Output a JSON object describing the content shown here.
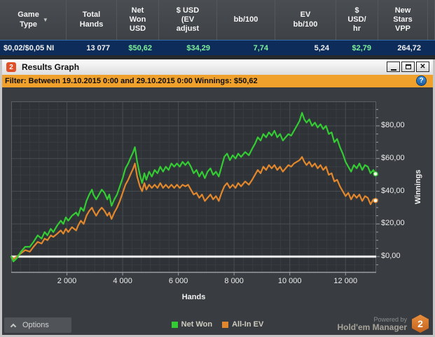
{
  "hud_table": {
    "columns": [
      {
        "label": "Game\nType",
        "width": 95,
        "sortable": true
      },
      {
        "label": "Total\nHands",
        "width": 72
      },
      {
        "label": "Net\nWon\nUSD",
        "width": 60
      },
      {
        "label": "$ USD\n(EV\nadjust",
        "width": 83
      },
      {
        "label": "bb/100",
        "width": 83
      },
      {
        "label": "EV\nbb/100",
        "width": 87
      },
      {
        "label": "$\nUSD/\nhr",
        "width": 60
      },
      {
        "label": "New\nStars\nVPP",
        "width": 71
      }
    ],
    "row": [
      {
        "value": "$0,02/$0,05 NI",
        "color": "white",
        "align": "left"
      },
      {
        "value": "13 077",
        "color": "white"
      },
      {
        "value": "$50,62",
        "color": "green"
      },
      {
        "value": "$34,29",
        "color": "green"
      },
      {
        "value": "7,74",
        "color": "green"
      },
      {
        "value": "5,24",
        "color": "white"
      },
      {
        "value": "$2,79",
        "color": "green"
      },
      {
        "value": "264,72",
        "color": "white"
      }
    ]
  },
  "window": {
    "title": "Results Graph",
    "logo_text": "2",
    "buttons": {
      "minimize": "_",
      "maximize": "",
      "close": "✕"
    },
    "filter_text": "Filter: Between 19.10.2015 0:00 and 29.10.2015 0:00 Winnings: $50,62",
    "help_icon": "?"
  },
  "footer": {
    "options_label": "Options",
    "powered_by_line1": "Powered by",
    "powered_by_line2": "Hold'em Manager",
    "logo_badge": "2"
  },
  "chart_data": {
    "type": "line",
    "xlabel": "Hands",
    "ylabel": "Winnings",
    "xlim": [
      0,
      13100
    ],
    "ylim": [
      -10,
      95
    ],
    "x_ticks": [
      2000,
      4000,
      6000,
      8000,
      10000,
      12000
    ],
    "x_tick_labels": [
      "2 000",
      "4 000",
      "6 000",
      "8 000",
      "10 000",
      "12 000"
    ],
    "y_ticks": [
      0,
      20,
      40,
      60,
      80
    ],
    "y_tick_labels": [
      "$0,00",
      "$20,00",
      "$40,00",
      "$60,00",
      "$80,00"
    ],
    "grid": true,
    "zero_line_color": "#f2f2f2",
    "legend_position": "bottom",
    "series": [
      {
        "name": "All-In EV",
        "color": "#e2872c",
        "final_value": "$34,29",
        "points": [
          [
            0,
            0
          ],
          [
            80,
            -1.5
          ],
          [
            200,
            0
          ],
          [
            350,
            2
          ],
          [
            500,
            4
          ],
          [
            670,
            3
          ],
          [
            800,
            6
          ],
          [
            950,
            9
          ],
          [
            1090,
            8
          ],
          [
            1200,
            11
          ],
          [
            1300,
            10
          ],
          [
            1420,
            13
          ],
          [
            1510,
            12
          ],
          [
            1650,
            14
          ],
          [
            1780,
            16
          ],
          [
            1870,
            14
          ],
          [
            1960,
            17
          ],
          [
            2050,
            15
          ],
          [
            2180,
            18
          ],
          [
            2330,
            16
          ],
          [
            2400,
            19
          ],
          [
            2500,
            22
          ],
          [
            2600,
            20
          ],
          [
            2700,
            25
          ],
          [
            2800,
            28
          ],
          [
            2900,
            30
          ],
          [
            2950,
            28
          ],
          [
            3050,
            25
          ],
          [
            3150,
            28
          ],
          [
            3250,
            30
          ],
          [
            3350,
            28
          ],
          [
            3450,
            25
          ],
          [
            3520,
            27
          ],
          [
            3600,
            23
          ],
          [
            3700,
            27
          ],
          [
            3800,
            30
          ],
          [
            3900,
            34
          ],
          [
            4000,
            39
          ],
          [
            4100,
            44
          ],
          [
            4200,
            47
          ],
          [
            4300,
            51
          ],
          [
            4380,
            54
          ],
          [
            4440,
            57
          ],
          [
            4520,
            49
          ],
          [
            4620,
            43
          ],
          [
            4700,
            40
          ],
          [
            4780,
            45
          ],
          [
            4850,
            41
          ],
          [
            4950,
            44
          ],
          [
            5050,
            42
          ],
          [
            5150,
            44
          ],
          [
            5250,
            42
          ],
          [
            5350,
            45
          ],
          [
            5450,
            42
          ],
          [
            5550,
            44
          ],
          [
            5650,
            42
          ],
          [
            5750,
            44
          ],
          [
            5850,
            42
          ],
          [
            5950,
            44
          ],
          [
            6050,
            42
          ],
          [
            6150,
            44
          ],
          [
            6250,
            43
          ],
          [
            6350,
            44
          ],
          [
            6450,
            41
          ],
          [
            6550,
            38
          ],
          [
            6650,
            39
          ],
          [
            6750,
            36
          ],
          [
            6850,
            38
          ],
          [
            6950,
            34
          ],
          [
            7050,
            36
          ],
          [
            7150,
            38
          ],
          [
            7250,
            35
          ],
          [
            7350,
            37
          ],
          [
            7450,
            34
          ],
          [
            7550,
            39
          ],
          [
            7650,
            43
          ],
          [
            7750,
            45
          ],
          [
            7850,
            42
          ],
          [
            7950,
            44
          ],
          [
            8050,
            42
          ],
          [
            8150,
            45
          ],
          [
            8250,
            43
          ],
          [
            8400,
            46
          ],
          [
            8530,
            44
          ],
          [
            8650,
            47
          ],
          [
            8750,
            50
          ],
          [
            8850,
            53
          ],
          [
            8950,
            51
          ],
          [
            9050,
            55
          ],
          [
            9150,
            53
          ],
          [
            9250,
            56
          ],
          [
            9350,
            54
          ],
          [
            9450,
            56
          ],
          [
            9550,
            53
          ],
          [
            9650,
            55
          ],
          [
            9750,
            52
          ],
          [
            9850,
            54
          ],
          [
            9950,
            56
          ],
          [
            10050,
            55
          ],
          [
            10150,
            57
          ],
          [
            10250,
            58
          ],
          [
            10350,
            59
          ],
          [
            10440,
            61
          ],
          [
            10520,
            58
          ],
          [
            10600,
            56
          ],
          [
            10700,
            58
          ],
          [
            10800,
            55
          ],
          [
            10900,
            57
          ],
          [
            11000,
            54
          ],
          [
            11100,
            56
          ],
          [
            11200,
            53
          ],
          [
            11300,
            55
          ],
          [
            11400,
            50
          ],
          [
            11500,
            51
          ],
          [
            11600,
            46
          ],
          [
            11700,
            47
          ],
          [
            11800,
            43
          ],
          [
            11900,
            40
          ],
          [
            12000,
            37
          ],
          [
            12100,
            39
          ],
          [
            12200,
            35
          ],
          [
            12300,
            38
          ],
          [
            12400,
            36
          ],
          [
            12500,
            38
          ],
          [
            12600,
            34
          ],
          [
            12700,
            37
          ],
          [
            12800,
            36
          ],
          [
            12900,
            32
          ],
          [
            13000,
            35
          ],
          [
            13077,
            34.3
          ]
        ]
      },
      {
        "name": "Net Won",
        "color": "#33cc33",
        "final_value": "$50,62",
        "points": [
          [
            0,
            0
          ],
          [
            80,
            -3
          ],
          [
            200,
            -1
          ],
          [
            350,
            3
          ],
          [
            500,
            6
          ],
          [
            670,
            6
          ],
          [
            800,
            9
          ],
          [
            950,
            13
          ],
          [
            1090,
            11
          ],
          [
            1200,
            15
          ],
          [
            1300,
            13
          ],
          [
            1420,
            17
          ],
          [
            1510,
            15
          ],
          [
            1650,
            19
          ],
          [
            1780,
            22
          ],
          [
            1870,
            20
          ],
          [
            1960,
            24
          ],
          [
            2050,
            22
          ],
          [
            2180,
            25
          ],
          [
            2330,
            27
          ],
          [
            2400,
            25
          ],
          [
            2500,
            30
          ],
          [
            2600,
            28
          ],
          [
            2700,
            34
          ],
          [
            2800,
            38
          ],
          [
            2900,
            41
          ],
          [
            2950,
            38
          ],
          [
            3050,
            35
          ],
          [
            3150,
            38
          ],
          [
            3250,
            41
          ],
          [
            3350,
            39
          ],
          [
            3450,
            35
          ],
          [
            3520,
            38
          ],
          [
            3600,
            31
          ],
          [
            3700,
            35
          ],
          [
            3800,
            38
          ],
          [
            3900,
            43
          ],
          [
            4000,
            48
          ],
          [
            4100,
            54
          ],
          [
            4200,
            57
          ],
          [
            4300,
            61
          ],
          [
            4380,
            64
          ],
          [
            4440,
            67
          ],
          [
            4520,
            58
          ],
          [
            4620,
            50
          ],
          [
            4700,
            45
          ],
          [
            4780,
            51
          ],
          [
            4850,
            47
          ],
          [
            4950,
            52
          ],
          [
            5050,
            49
          ],
          [
            5150,
            53
          ],
          [
            5250,
            51
          ],
          [
            5350,
            55
          ],
          [
            5450,
            52
          ],
          [
            5550,
            55
          ],
          [
            5650,
            53
          ],
          [
            5750,
            57
          ],
          [
            5850,
            55
          ],
          [
            5950,
            57
          ],
          [
            6050,
            55
          ],
          [
            6150,
            58
          ],
          [
            6250,
            56
          ],
          [
            6350,
            58
          ],
          [
            6450,
            55
          ],
          [
            6550,
            51
          ],
          [
            6650,
            53
          ],
          [
            6750,
            49
          ],
          [
            6850,
            52
          ],
          [
            6950,
            48
          ],
          [
            7050,
            52
          ],
          [
            7150,
            54
          ],
          [
            7250,
            50
          ],
          [
            7350,
            52
          ],
          [
            7450,
            49
          ],
          [
            7550,
            55
          ],
          [
            7650,
            61
          ],
          [
            7750,
            63
          ],
          [
            7850,
            59
          ],
          [
            7950,
            62
          ],
          [
            8050,
            60
          ],
          [
            8150,
            63
          ],
          [
            8250,
            61
          ],
          [
            8400,
            64
          ],
          [
            8530,
            62
          ],
          [
            8650,
            66
          ],
          [
            8750,
            69
          ],
          [
            8850,
            73
          ],
          [
            8950,
            71
          ],
          [
            9050,
            75
          ],
          [
            9150,
            73
          ],
          [
            9250,
            76
          ],
          [
            9350,
            74
          ],
          [
            9450,
            77
          ],
          [
            9550,
            73
          ],
          [
            9650,
            75
          ],
          [
            9750,
            71
          ],
          [
            9850,
            73
          ],
          [
            9950,
            75
          ],
          [
            10050,
            74
          ],
          [
            10150,
            77
          ],
          [
            10250,
            80
          ],
          [
            10350,
            83
          ],
          [
            10440,
            88
          ],
          [
            10520,
            84
          ],
          [
            10600,
            82
          ],
          [
            10700,
            84
          ],
          [
            10800,
            80
          ],
          [
            10900,
            82
          ],
          [
            11000,
            79
          ],
          [
            11100,
            81
          ],
          [
            11200,
            78
          ],
          [
            11300,
            80
          ],
          [
            11400,
            75
          ],
          [
            11500,
            76
          ],
          [
            11600,
            70
          ],
          [
            11700,
            72
          ],
          [
            11800,
            67
          ],
          [
            11900,
            63
          ],
          [
            12000,
            58
          ],
          [
            12100,
            55
          ],
          [
            12200,
            52
          ],
          [
            12300,
            56
          ],
          [
            12400,
            54
          ],
          [
            12500,
            57
          ],
          [
            12600,
            53
          ],
          [
            12700,
            56
          ],
          [
            12800,
            55
          ],
          [
            12900,
            51
          ],
          [
            13000,
            53
          ],
          [
            13077,
            50.6
          ]
        ]
      }
    ]
  }
}
